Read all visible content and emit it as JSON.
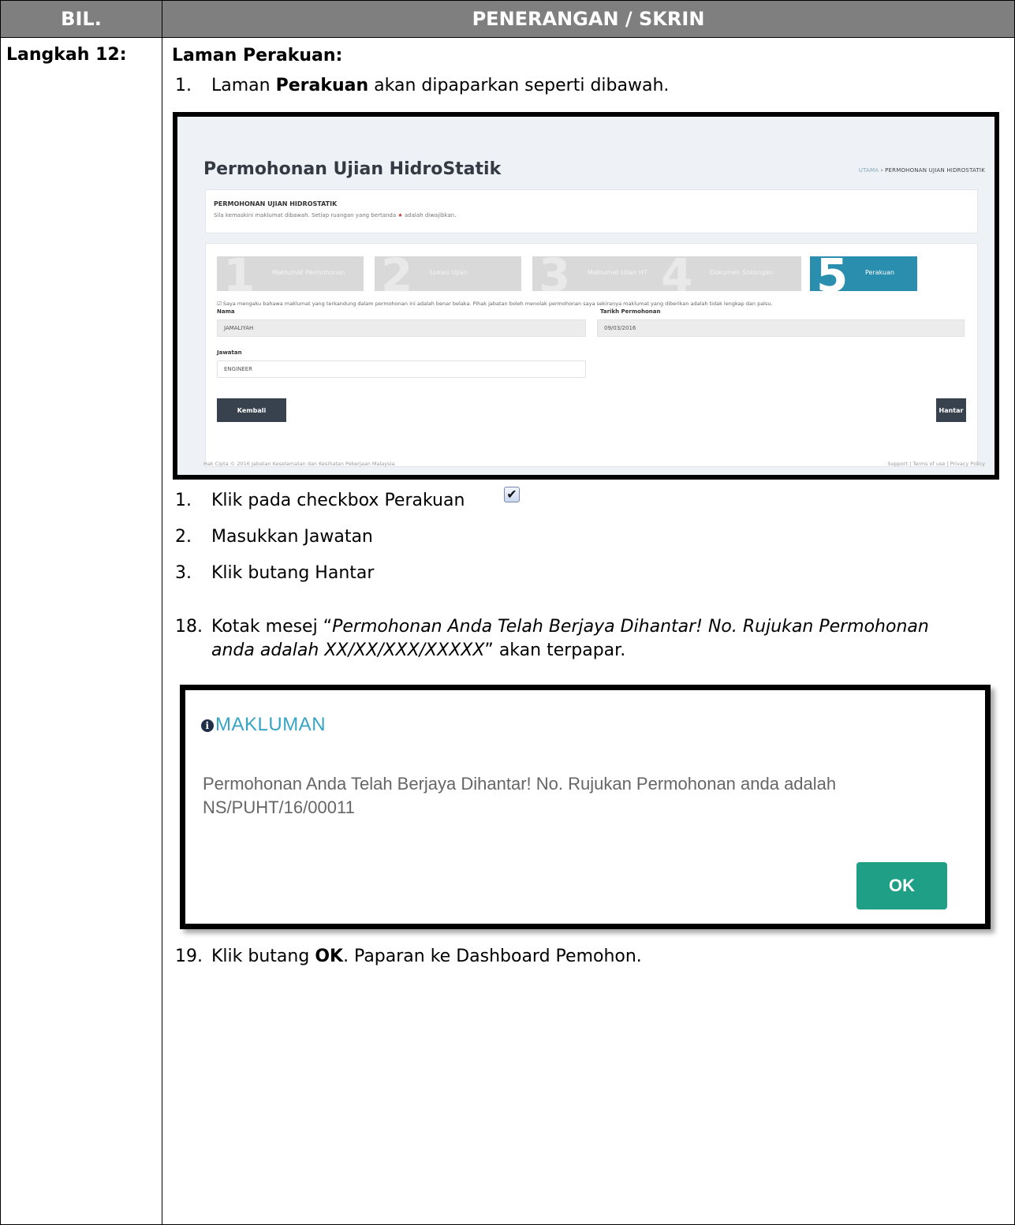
{
  "table": {
    "col_step_header": "BIL.",
    "col_desc_header": "PENERANGAN / SKRIN",
    "step_label": "Langkah 12:"
  },
  "content": {
    "section_title": "Laman Perakuan:",
    "intro": {
      "num": "1.",
      "pre": "Laman ",
      "bold": "Perakuan",
      "post": " akan dipaparkan seperti dibawah."
    },
    "instructions": [
      {
        "num": "1.",
        "text": "Klik pada checkbox Perakuan"
      },
      {
        "num": "2.",
        "text": "Masukkan Jawatan"
      },
      {
        "num": "3.",
        "text": "Klik butang Hantar"
      }
    ],
    "step18": {
      "num": "18.",
      "line1_pre": "Kotak mesej “",
      "line1_italic": "Permohonan Anda Telah Berjaya Dihantar! No. Rujukan Permohonan",
      "line2_italic": "anda adalah XX/XX/XXX/XXXXX",
      "line2_post": "” akan terpapar."
    },
    "step19": {
      "num": "19.",
      "pre": "Klik butang ",
      "bold": "OK",
      "post": ". Paparan ke Dashboard Pemohon."
    }
  },
  "app_screen": {
    "title": "Permohonan Ujian HidroStatik",
    "breadcrumb_home": "UTAMA",
    "breadcrumb_current": "PERMOHONAN UJIAN HIDROSTATIK",
    "panel_title": "PERMOHONAN UJIAN HIDROSTATIK",
    "panel_subtitle_pre": "Sila kemaskini maklumat dibawah. Setiap ruangan yang bertanda ",
    "panel_subtitle_post": " adalah diwajibkan.",
    "required_star": "★",
    "steps": [
      {
        "num": "1",
        "label": "Maklumat Permohonan"
      },
      {
        "num": "2",
        "label": "Lokasi Ujian"
      },
      {
        "num": "3",
        "label": "Maklumat Ujian HT"
      },
      {
        "num": "4",
        "label": "Dokumen Sokongan"
      },
      {
        "num": "5",
        "label": "Perakuan"
      }
    ],
    "declaration": "☑ Saya mengaku bahawa maklumat yang terkandung dalam permohonan ini adalah benar belaka. Pihak jabatan boleh menolak permohonan saya sekiranya maklumat yang diberikan adalah tidak lengkap dan palsu.",
    "nama_label": "Nama",
    "nama_value": "JAMALIYAH",
    "tarikh_label": "Tarikh Permohonan",
    "tarikh_value": "09/03/2016",
    "jawatan_label": "Jawatan",
    "jawatan_value": "ENGINEER",
    "back_button": "Kembali",
    "submit_button": "Hantar",
    "footer_left": "Hak Cipta © 2016 Jabatan Keselamatan dan Kesihatan Pekerjaan Malaysia",
    "footer_right": "Support | Terms of use | Privacy Policy"
  },
  "dialog": {
    "title": "MAKLUMAN",
    "message": "Permohonan Anda Telah Berjaya Dihantar! No. Rujukan Permohonan anda adalah NS/PUHT/16/00011",
    "ok_button": "OK"
  },
  "icons": {
    "checkbox": "checked-checkbox-icon",
    "info": "info-circle-icon"
  },
  "colors": {
    "header_bg": "#7f7f7f",
    "active_step": "#2a8fae",
    "dialog_title": "#36a4c4",
    "ok_button": "#1e9f86",
    "dark_button": "#37424e"
  }
}
